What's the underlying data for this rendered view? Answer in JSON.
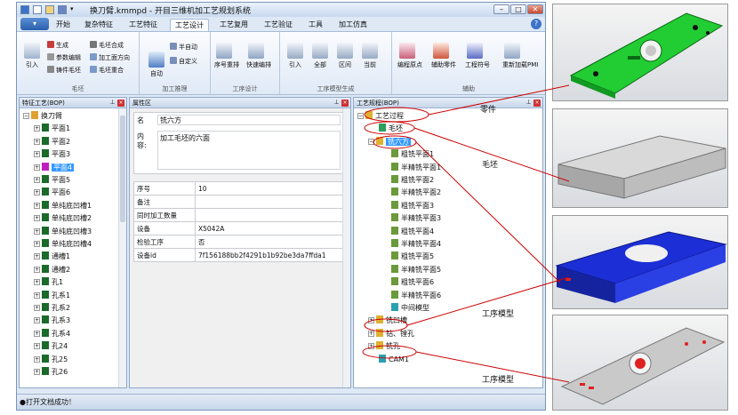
{
  "window": {
    "title": "换刀臂.kmmpd - 开目三维机加工艺规划系统",
    "min": "–",
    "max": "□",
    "close": "✕"
  },
  "menu": {
    "app": "▾",
    "tabs": [
      "开始",
      "复杂特征",
      "工艺特征",
      "工艺设计",
      "工艺复用",
      "工艺验证",
      "工具",
      "加工仿真"
    ],
    "help": "?"
  },
  "ribbon": {
    "groups": {
      "blank": {
        "label": "毛坯",
        "big": "引入",
        "small": [
          "生成",
          "参数编辑",
          "铸件毛坯",
          "毛坯合成",
          "加工面方向",
          "毛坯重合"
        ]
      },
      "process_reasoning": {
        "label": "加工推理",
        "big": "自动",
        "small": [
          "半自动",
          "自定义"
        ]
      },
      "process_design": {
        "label": "工序设计",
        "buttons": [
          "序号重排",
          "快速编排"
        ]
      },
      "model_gen": {
        "label": "工序模型生成",
        "buttons": [
          "引入",
          "全部",
          "区间",
          "当前"
        ]
      },
      "aux": {
        "label": "辅助",
        "buttons": [
          "编程原点",
          "辅助零件",
          "工程符号",
          "重新加载PMI"
        ]
      }
    }
  },
  "left_panel": {
    "title": "特征工艺(BOP)",
    "root": "换刀臂",
    "items": [
      "平面1",
      "平面2",
      "平面3",
      "平面4",
      "平面5",
      "平面6",
      "单纯底凹槽1",
      "单纯底凹槽2",
      "单纯底凹槽3",
      "单纯底凹槽4",
      "通槽1",
      "通槽2",
      "孔1",
      "孔系1",
      "孔系2",
      "孔系3",
      "孔系4",
      "孔24",
      "孔25",
      "孔26"
    ],
    "selected_index": 3
  },
  "prop_panel": {
    "title": "属性区",
    "name_label": "名",
    "name_value": "铣六方",
    "content_label": "内容:",
    "content_value": "加工毛坯的六面",
    "rows": [
      {
        "k": "序号",
        "v": "10"
      },
      {
        "k": "备注",
        "v": ""
      },
      {
        "k": "同时加工数量",
        "v": ""
      },
      {
        "k": "设备",
        "v": "X5042A"
      },
      {
        "k": "检验工序",
        "v": "否"
      },
      {
        "k": "设备id",
        "v": "7f156188bb2f4291b1b92be3da7ffda1"
      }
    ]
  },
  "right_panel": {
    "title": "工艺规程(BOP)",
    "root": "工艺过程",
    "blank": "毛坯",
    "op1": "铣六方",
    "steps": [
      "粗铣平面1",
      "半精铣平面1",
      "粗铣平面2",
      "半精铣平面2",
      "粗铣平面3",
      "半精铣平面3",
      "粗铣平面4",
      "半精铣平面4",
      "粗铣平面5",
      "半精铣平面5",
      "粗铣平面6",
      "半精铣平面6"
    ],
    "mid_model": "中间模型",
    "ops": [
      "铣凹槽",
      "钻、镗孔",
      "铣孔"
    ],
    "cam": "CAM1"
  },
  "status": {
    "text": "●打开文档成功！"
  },
  "annotations": {
    "part": "零件",
    "blank": "毛坯",
    "op_model_1": "工序模型",
    "op_model_2": "工序模型"
  },
  "colors": {
    "ribbon_blue": "#2a5fab",
    "selection": "#3399ff",
    "green_part": "#22cc33",
    "blue_model": "#1c2fd6",
    "annotation_red": "#cc0000"
  }
}
